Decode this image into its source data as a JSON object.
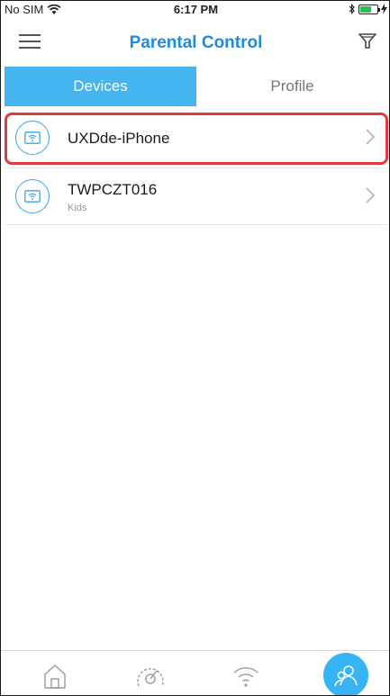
{
  "status_bar": {
    "carrier": "No SIM",
    "time": "6:17 PM"
  },
  "navbar": {
    "title": "Parental Control"
  },
  "tabs": [
    {
      "label": "Devices",
      "active": true
    },
    {
      "label": "Profile",
      "active": false
    }
  ],
  "devices": [
    {
      "name": "UXDde-iPhone",
      "subtitle": ""
    },
    {
      "name": "TWPCZT016",
      "subtitle": "Kids"
    }
  ],
  "bottom_nav": {
    "items": [
      "home-icon",
      "speedometer-icon",
      "wifi-icon",
      "parental-control-icon"
    ],
    "active_index": 3
  },
  "colors": {
    "accent": "#1c8ce0",
    "tab_active": "#45b5f2",
    "highlight": "#e0393e",
    "icon_blue": "#3ba6e8"
  }
}
